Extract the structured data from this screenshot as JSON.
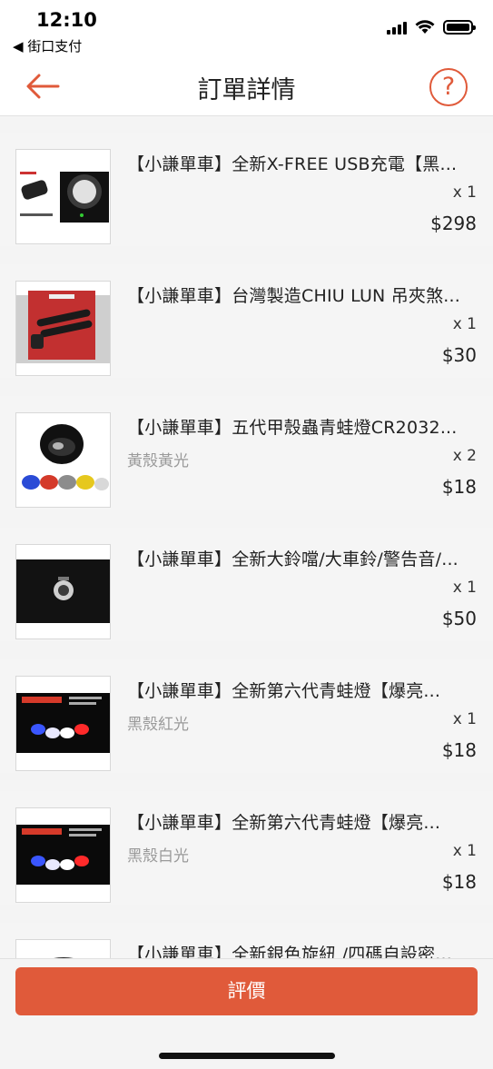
{
  "status_bar": {
    "time": "12:10",
    "back_app": "◀ 街口支付"
  },
  "header": {
    "title": "訂單詳情",
    "help_glyph": "?"
  },
  "items": [
    {
      "title": "【小謙單車】全新X-FREE USB充電【黑...",
      "variant": "",
      "qty": "x 1",
      "price": "$298",
      "thumb_icon": "usb-light-product-icon"
    },
    {
      "title": "【小謙單車】台灣製造CHIU LUN 吊夾煞...",
      "variant": "",
      "qty": "x 1",
      "price": "$30",
      "thumb_icon": "brake-clip-product-icon"
    },
    {
      "title": "【小謙單車】五代甲殼蟲青蛙燈CR2032...",
      "variant": "黃殼黃光",
      "qty": "x 2",
      "price": "$18",
      "thumb_icon": "frog-light-product-icon"
    },
    {
      "title": "【小謙單車】全新大鈴噹/大車鈴/警告音/...",
      "variant": "",
      "qty": "x 1",
      "price": "$50",
      "thumb_icon": "bell-product-icon"
    },
    {
      "title": "【小謙單車】全新第六代青蛙燈【爆亮...",
      "variant": "黑殼紅光",
      "qty": "x 1",
      "price": "$18",
      "thumb_icon": "frog-light-6-product-icon"
    },
    {
      "title": "【小謙單車】全新第六代青蛙燈【爆亮...",
      "variant": "黑殼白光",
      "qty": "x 1",
      "price": "$18",
      "thumb_icon": "frog-light-6-product-icon"
    },
    {
      "title": "【小謙單車】全新銀色旋紐 /四碼自設密...",
      "variant": "",
      "qty": "",
      "price": "",
      "thumb_icon": "cable-lock-product-icon"
    }
  ],
  "footer": {
    "review_label": "評價"
  },
  "colors": {
    "accent": "#e05a3a",
    "background": "#f4f4f4"
  }
}
